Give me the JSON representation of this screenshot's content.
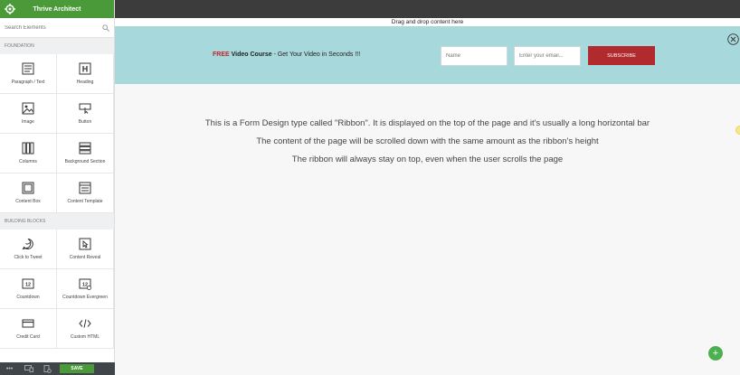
{
  "sidebar": {
    "title": "Thrive Architect",
    "search_placeholder": "Search Elements",
    "sections": [
      {
        "title": "FOUNDATION",
        "items": [
          {
            "label": "Paragraph / Text",
            "icon": "paragraph-icon"
          },
          {
            "label": "Heading",
            "icon": "heading-icon"
          },
          {
            "label": "Image",
            "icon": "image-icon"
          },
          {
            "label": "Button",
            "icon": "button-icon"
          },
          {
            "label": "Columns",
            "icon": "columns-icon"
          },
          {
            "label": "Background Section",
            "icon": "background-section-icon"
          },
          {
            "label": "Content Box",
            "icon": "content-box-icon"
          },
          {
            "label": "Content Template",
            "icon": "content-template-icon"
          }
        ]
      },
      {
        "title": "BUILDING BLOCKS",
        "items": [
          {
            "label": "Click to Tweet",
            "icon": "tweet-icon"
          },
          {
            "label": "Content Reveal",
            "icon": "content-reveal-icon"
          },
          {
            "label": "Countdown",
            "icon": "countdown-icon"
          },
          {
            "label": "Countdown Evergreen",
            "icon": "countdown-evergreen-icon"
          },
          {
            "label": "Credit Card",
            "icon": "credit-card-icon"
          },
          {
            "label": "Custom HTML",
            "icon": "custom-html-icon"
          }
        ]
      }
    ],
    "footer": {
      "more": "•••",
      "save_label": "SAVE"
    }
  },
  "canvas": {
    "drop_hint": "Drag and drop content here",
    "ribbon": {
      "free": "FREE",
      "course": "Video Course",
      "rest": " - Get Your Video in Seconds !!!",
      "name_placeholder": "Name",
      "email_placeholder": "Enter your email...",
      "subscribe_label": "SUBSCRIBE"
    },
    "paragraphs": [
      "This is a Form Design type called \"Ribbon\". It is displayed on the top of the page and it's usually a long horizontal bar",
      "The content of the page will be scrolled down with the same amount as the ribbon's height",
      "The ribbon will always stay on top, even when the user scrolls the page"
    ],
    "add_label": "+"
  },
  "colors": {
    "header_green": "#4a9a3a",
    "ribbon_bg": "#a7d8db",
    "subscribe_red": "#b02a2e",
    "free_red": "#c0242b"
  }
}
